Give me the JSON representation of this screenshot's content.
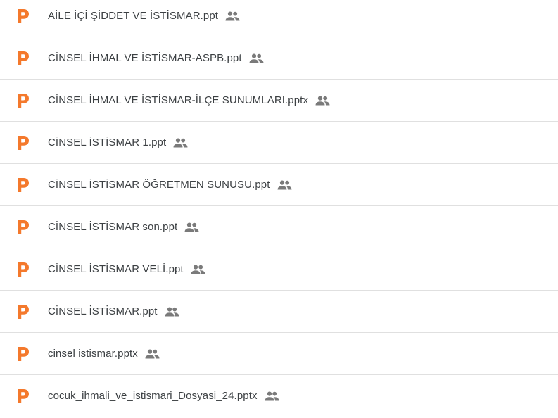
{
  "colors": {
    "ppt_icon": "#f4792c",
    "shared_icon": "#7a7a7a",
    "text": "#3c4043",
    "divider": "#e0e0e0"
  },
  "files": [
    {
      "name": "AİLE İÇİ ŞİDDET VE İSTİSMAR.ppt",
      "icon": "powerpoint-icon",
      "shared": true
    },
    {
      "name": "CİNSEL İHMAL VE İSTİSMAR-ASPB.ppt",
      "icon": "powerpoint-icon",
      "shared": true
    },
    {
      "name": "CİNSEL İHMAL VE İSTİSMAR-İLÇE SUNUMLARI.pptx",
      "icon": "powerpoint-icon",
      "shared": true
    },
    {
      "name": "CİNSEL İSTİSMAR 1.ppt",
      "icon": "powerpoint-icon",
      "shared": true
    },
    {
      "name": "CİNSEL İSTİSMAR ÖĞRETMEN SUNUSU.ppt",
      "icon": "powerpoint-icon",
      "shared": true
    },
    {
      "name": "CİNSEL İSTİSMAR son.ppt",
      "icon": "powerpoint-icon",
      "shared": true
    },
    {
      "name": "CİNSEL İSTİSMAR VELİ.ppt",
      "icon": "powerpoint-icon",
      "shared": true
    },
    {
      "name": "CİNSEL İSTİSMAR.ppt",
      "icon": "powerpoint-icon",
      "shared": true
    },
    {
      "name": "cinsel istismar.pptx",
      "icon": "powerpoint-icon",
      "shared": true
    },
    {
      "name": "cocuk_ihmali_ve_istismari_Dosyasi_24.pptx",
      "icon": "powerpoint-icon",
      "shared": true
    }
  ]
}
